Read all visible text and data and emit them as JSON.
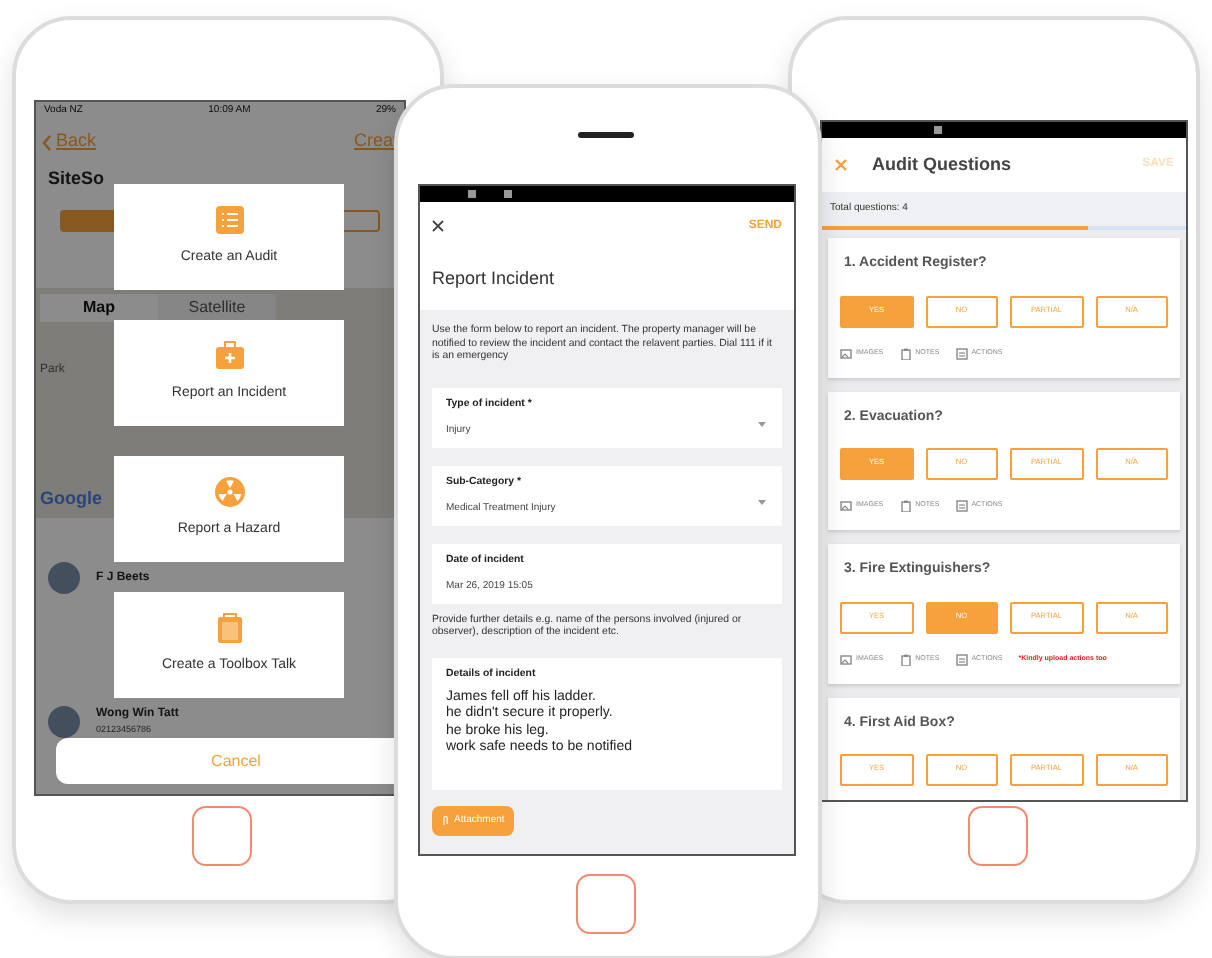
{
  "left_phone": {
    "status_bar": {
      "carrier": "Voda NZ",
      "time": "10:09 AM",
      "battery": "29%"
    },
    "back": "Back",
    "action": "Creat",
    "site_name": "SiteSo",
    "map_tabs": [
      {
        "label": "Map",
        "selected": true
      },
      {
        "label": "Satellite",
        "selected": false
      }
    ],
    "map_labels": [
      "Park",
      "Google"
    ],
    "contacts": [
      {
        "name": "F J Beets"
      },
      {
        "name": "Wong Win Tatt",
        "phone": "02123456786"
      }
    ],
    "menu": [
      {
        "label": "Create an Audit",
        "kind": "list"
      },
      {
        "label": "Report an Incident",
        "kind": "kit"
      },
      {
        "label": "Report a Hazard",
        "kind": "hazard"
      },
      {
        "label": "Create a Toolbox Talk",
        "kind": "clipboard"
      }
    ],
    "cancel": "Cancel"
  },
  "middle_phone": {
    "send": "SEND",
    "title": "Report Incident",
    "intro": "Use the form below to report an incident. The property manager will be notified to review the incident and contact the relavent parties. Dial 111 if it is an emergency",
    "fields": [
      {
        "label": "Type of incident *",
        "value": "Injury",
        "kind": "select"
      },
      {
        "label": "Sub-Category *",
        "value": "Medical Treatment Injury",
        "kind": "select"
      },
      {
        "label": "Date of incident",
        "value": "Mar 26, 2019 15:05",
        "kind": "text"
      }
    ],
    "further": "Provide further details e.g. name of the persons involved (injured or observer), description of the incident etc.",
    "details": {
      "label": "Details of incident",
      "lines": [
        "James fell off his ladder.",
        "he didn't secure it properly.",
        "he broke his leg.",
        "work safe needs to be notified"
      ]
    },
    "attachment": "Attachment"
  },
  "right_phone": {
    "title": "Audit Questions",
    "save": {
      "label": "SAVE",
      "disabled": true
    },
    "total": "Total questions: 4",
    "progress": {
      "level": 0.73
    },
    "questions": [
      {
        "title": "1. Accident Register?",
        "options": [
          {
            "label": "YES",
            "selected": true
          },
          {
            "label": "NO",
            "selected": false
          },
          {
            "label": "PARTIAL",
            "selected": false
          },
          {
            "label": "N/A",
            "selected": false
          }
        ],
        "tools": [
          "IMAGES",
          "NOTES",
          "ACTIONS"
        ]
      },
      {
        "title": "2. Evacuation?",
        "options": [
          {
            "label": "YES",
            "selected": true
          },
          {
            "label": "NO",
            "selected": false
          },
          {
            "label": "PARTIAL",
            "selected": false
          },
          {
            "label": "N/A",
            "selected": false
          }
        ],
        "tools": [
          "IMAGES",
          "NOTES",
          "ACTIONS"
        ]
      },
      {
        "title": "3. Fire Extinguishers?",
        "options": [
          {
            "label": "YES",
            "selected": false
          },
          {
            "label": "NO",
            "selected": true
          },
          {
            "label": "PARTIAL",
            "selected": false
          },
          {
            "label": "N/A",
            "selected": false
          }
        ],
        "tools": [
          "IMAGES",
          "NOTES",
          "ACTIONS"
        ],
        "warning": "*Kindly upload actions too"
      },
      {
        "title": "4. First Aid Box?",
        "options": [
          {
            "label": "YES",
            "selected": false
          },
          {
            "label": "NO",
            "selected": false
          },
          {
            "label": "PARTIAL",
            "selected": false
          },
          {
            "label": "N/A",
            "selected": false
          }
        ]
      }
    ]
  }
}
